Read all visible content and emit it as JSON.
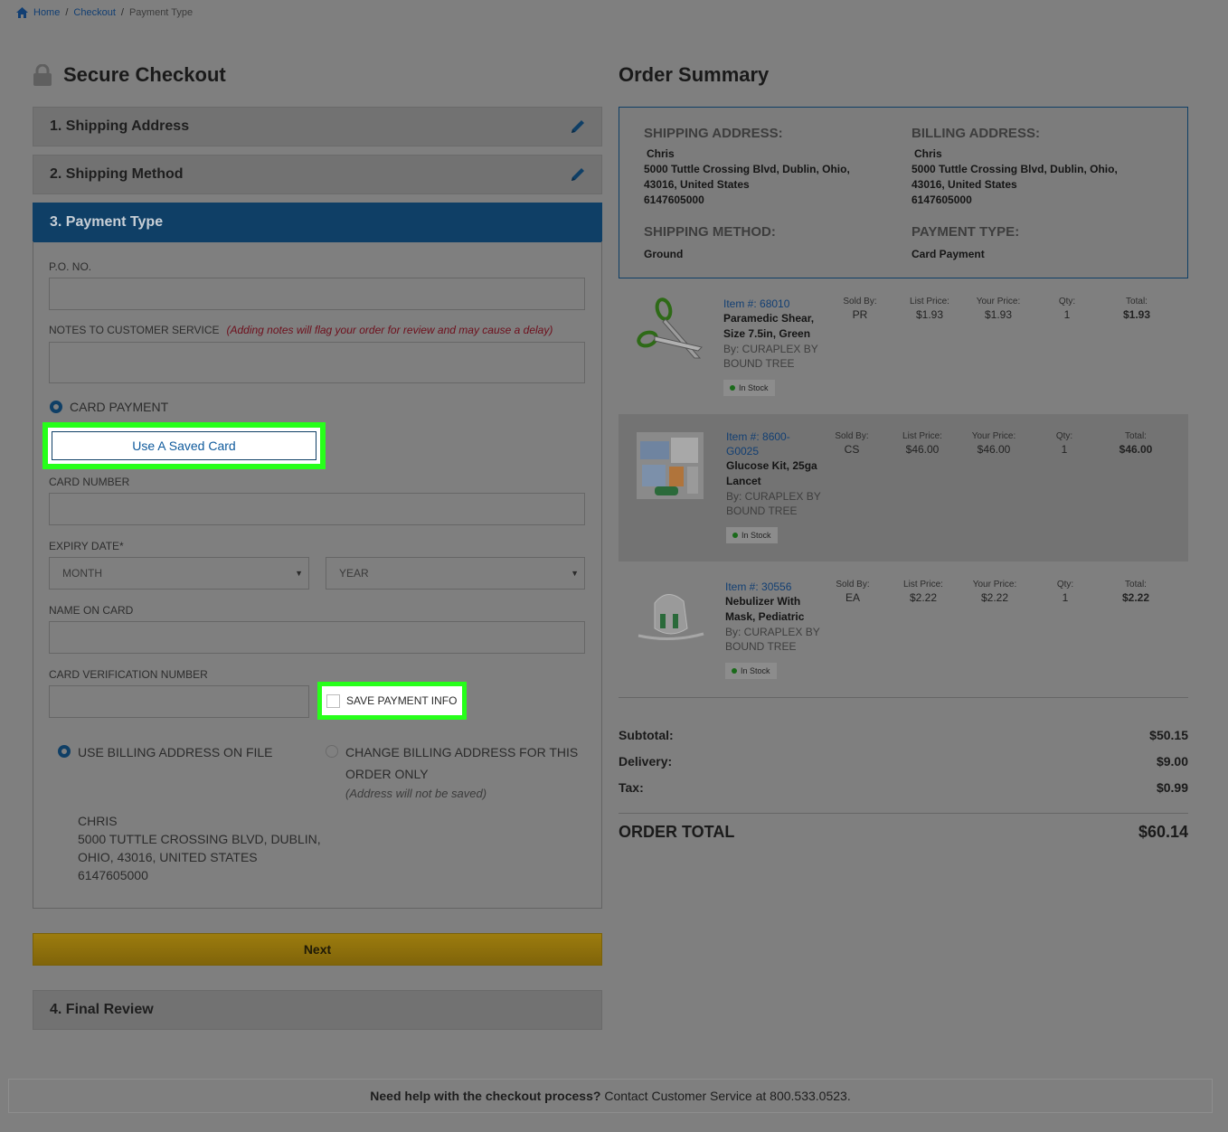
{
  "breadcrumb": {
    "home": "Home",
    "checkout": "Checkout",
    "current": "Payment Type"
  },
  "checkout": {
    "title": "Secure Checkout",
    "steps": [
      {
        "label": "1. Shipping Address"
      },
      {
        "label": "2. Shipping Method"
      },
      {
        "label": "3. Payment Type"
      },
      {
        "label": "4. Final Review"
      }
    ]
  },
  "payment": {
    "po_label": "P.O. NO.",
    "notes_label": "NOTES TO CUSTOMER SERVICE",
    "notes_warning": "(Adding notes will flag your order for review and may cause a delay)",
    "card_payment_label": "CARD PAYMENT",
    "use_saved_card": "Use A Saved Card",
    "card_number_label": "CARD NUMBER",
    "expiry_label": "EXPIRY DATE*",
    "month_placeholder": "MONTH",
    "year_placeholder": "YEAR",
    "name_label": "NAME ON CARD",
    "cvn_label": "CARD VERIFICATION NUMBER",
    "save_payment_label": "SAVE PAYMENT INFO",
    "use_billing_label": "USE BILLING ADDRESS ON FILE",
    "change_billing_line1": "CHANGE BILLING ADDRESS FOR THIS",
    "change_billing_line2": "ORDER ONLY",
    "address_note": "(Address will not be saved)",
    "billing_address": {
      "name": "CHRIS",
      "line1": "5000 TUTTLE CROSSING BLVD,  DUBLIN,",
      "line2": "OHIO,  43016,  UNITED STATES",
      "phone": "6147605000"
    },
    "next_label": "Next"
  },
  "summary": {
    "title": "Order Summary",
    "shipping_address_head": "SHIPPING ADDRESS:",
    "billing_address_head": "BILLING ADDRESS:",
    "shipping_method_head": "SHIPPING METHOD:",
    "payment_type_head": "PAYMENT TYPE:",
    "shipping": {
      "name": "Chris",
      "line1": "5000 Tuttle Crossing Blvd,  Dublin,  Ohio,",
      "line2": "43016,  United States",
      "phone": "6147605000"
    },
    "billing": {
      "name": "Chris",
      "line1": "5000 Tuttle Crossing Blvd,  Dublin,  Ohio,",
      "line2": "43016,  United States",
      "phone": "6147605000"
    },
    "shipping_method": "Ground",
    "payment_type": "Card Payment"
  },
  "columns": {
    "sold_by": "Sold By:",
    "list_price": "List Price:",
    "your_price": "Your Price:",
    "qty": "Qty:",
    "total": "Total:"
  },
  "items": [
    {
      "item_num_a": "Item #: 68010",
      "item_num_b": "",
      "name_a": "Paramedic Shear,",
      "name_b": "Size 7.5in, Green",
      "brand_a": "By: CURAPLEX BY",
      "brand_b": "BOUND TREE",
      "stock": "In Stock",
      "sold_by": "PR",
      "list_price": "$1.93",
      "your_price": "$1.93",
      "qty": "1",
      "total": "$1.93"
    },
    {
      "item_num_a": "Item #: 8600-",
      "item_num_b": "G0025",
      "name_a": "Glucose Kit, 25ga",
      "name_b": "Lancet",
      "brand_a": "By: CURAPLEX BY",
      "brand_b": "BOUND TREE",
      "stock": "In Stock",
      "sold_by": "CS",
      "list_price": "$46.00",
      "your_price": "$46.00",
      "qty": "1",
      "total": "$46.00"
    },
    {
      "item_num_a": "Item #: 30556",
      "item_num_b": "",
      "name_a": "Nebulizer With",
      "name_b": "Mask, Pediatric",
      "brand_a": "By: CURAPLEX BY",
      "brand_b": "BOUND TREE",
      "stock": "In Stock",
      "sold_by": "EA",
      "list_price": "$2.22",
      "your_price": "$2.22",
      "qty": "1",
      "total": "$2.22"
    }
  ],
  "totals": {
    "subtotal_label": "Subtotal:",
    "subtotal": "$50.15",
    "delivery_label": "Delivery:",
    "delivery": "$9.00",
    "tax_label": "Tax:",
    "tax": "$0.99",
    "order_total_label": "ORDER TOTAL",
    "order_total": "$60.14"
  },
  "help": {
    "lead": "Need help with the checkout process?",
    "rest": " Contact Customer Service at 800.533.0523."
  }
}
